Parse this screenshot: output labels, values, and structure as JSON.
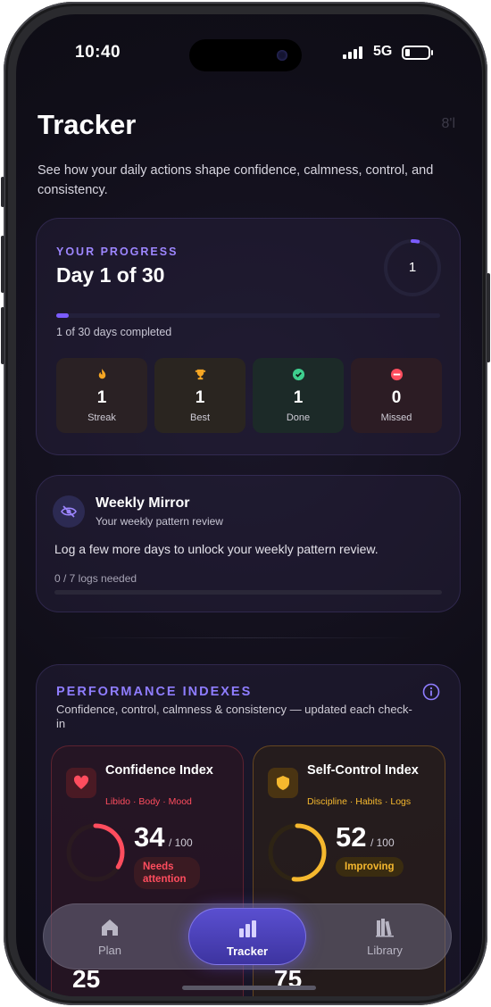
{
  "status_bar": {
    "time": "10:40",
    "network": "5G"
  },
  "header": {
    "title": "Tracker",
    "top_icon_text": "8'l",
    "subtitle": "See how your daily actions shape confidence, calmness, control, and consistency."
  },
  "progress": {
    "eyebrow": "YOUR PROGRESS",
    "day_title": "Day 1 of 30",
    "ring_value": "1",
    "completed_fraction": 0.033,
    "bar_note": "1 of 30 days completed",
    "stats": [
      {
        "value": "1",
        "label": "Streak",
        "icon": "flame-icon",
        "color": "#f5a623"
      },
      {
        "value": "1",
        "label": "Best",
        "icon": "trophy-icon",
        "color": "#f5a623"
      },
      {
        "value": "1",
        "label": "Done",
        "icon": "check-badge-icon",
        "color": "#3ecf8e"
      },
      {
        "value": "0",
        "label": "Missed",
        "icon": "minus-circle-icon",
        "color": "#ff4d5e"
      }
    ]
  },
  "weekly_mirror": {
    "title": "Weekly Mirror",
    "subtitle": "Your weekly pattern review",
    "message": "Log a few more days to unlock your weekly pattern review.",
    "logs_note": "0 / 7 logs needed",
    "logs_fraction": 0
  },
  "performance": {
    "title": "PERFORMANCE INDEXES",
    "subtitle": "Confidence, control, calmness & consistency — updated each check-in",
    "indexes": [
      {
        "title": "Confidence Index",
        "tags": "Libido · Body · Mood",
        "score": "34",
        "max": "/ 100",
        "badge": "Needs attention",
        "color": "#ff4d5e",
        "fraction": 0.34
      },
      {
        "title": "Self-Control Index",
        "tags": "Discipline · Habits · Logs",
        "score": "52",
        "max": "/ 100",
        "badge": "Improving",
        "color": "#f5b82e",
        "fraction": 0.52
      }
    ],
    "next_row": [
      {
        "score": "25",
        "color": "#ff4d5e",
        "fraction": 0.25
      },
      {
        "score": "75",
        "color": "#3ecf8e",
        "fraction": 0.75
      }
    ]
  },
  "tabbar": {
    "tabs": [
      {
        "label": "Plan",
        "icon": "home-icon"
      },
      {
        "label": "Tracker",
        "icon": "bar-chart-icon"
      },
      {
        "label": "Library",
        "icon": "books-icon"
      }
    ],
    "active": "Tracker"
  }
}
